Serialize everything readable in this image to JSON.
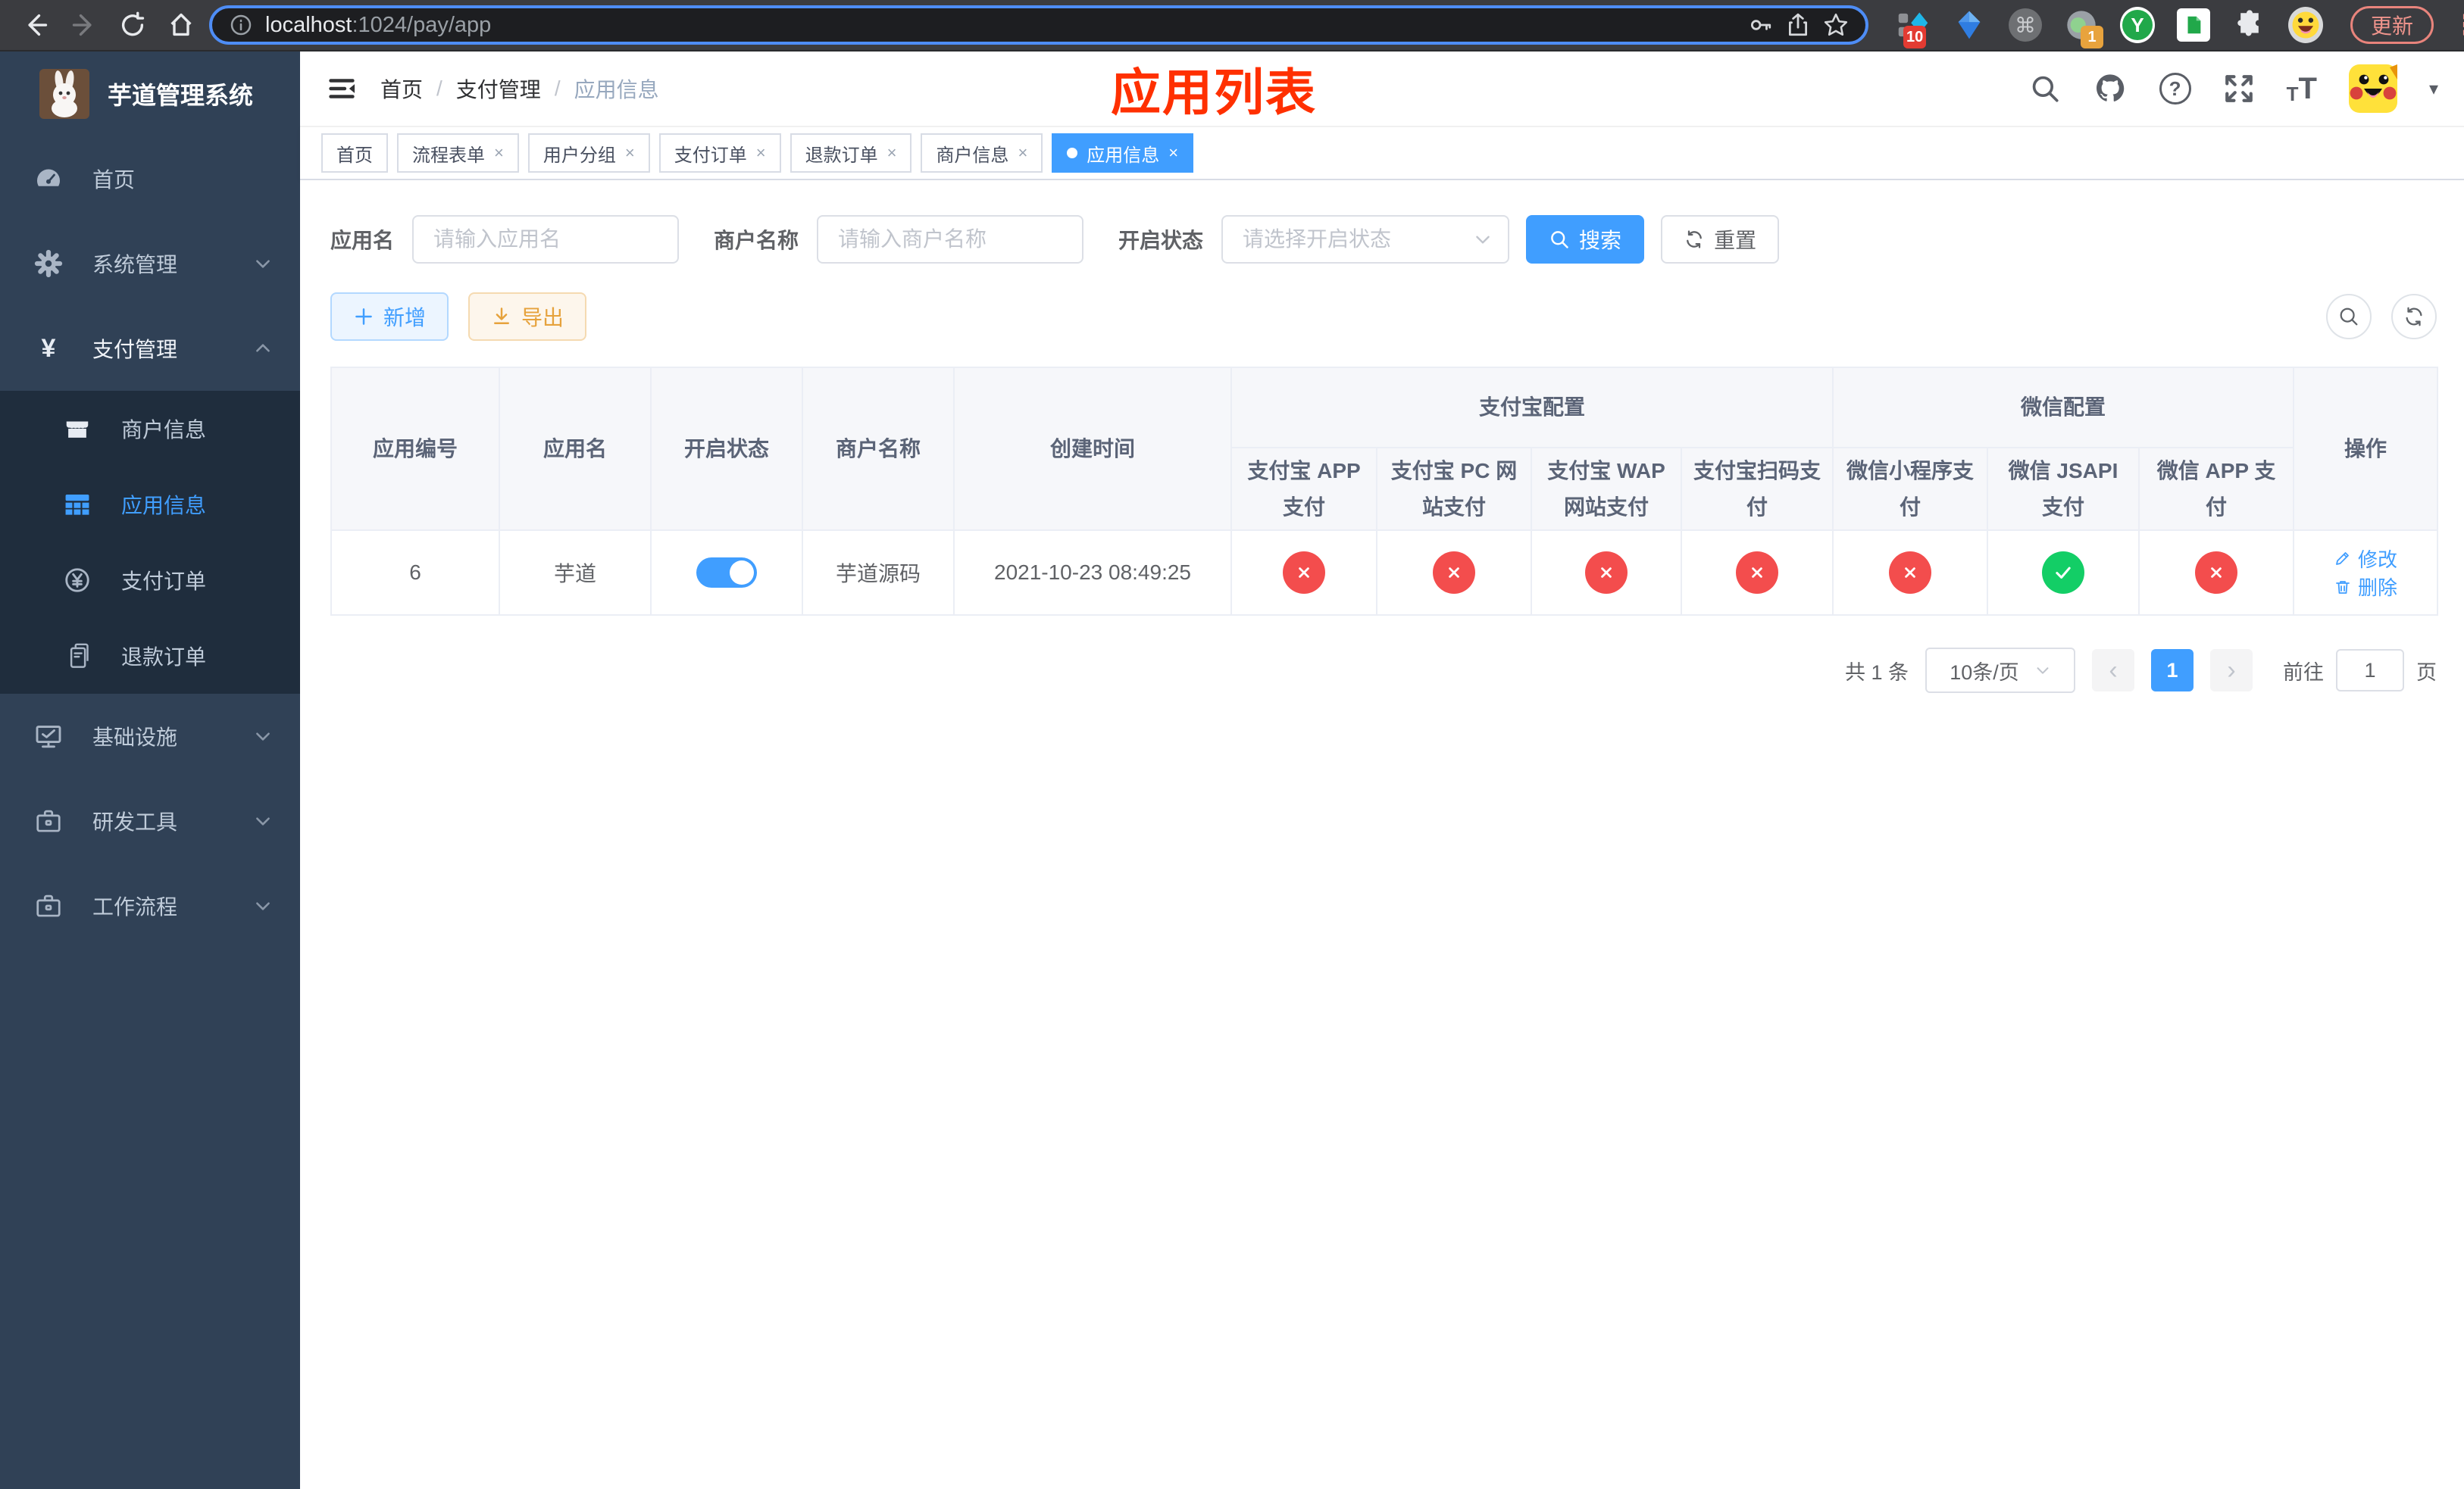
{
  "colors": {
    "primary": "#409eff",
    "danger": "#f34d4d",
    "success": "#13ce66",
    "warning": "#e6a23c",
    "title_red": "#ff3000",
    "sidebar_bg": "#304156",
    "submenu_bg": "#1f2d3d"
  },
  "icons": {
    "question": "?",
    "command": "⌘",
    "kebab": "⋮",
    "caret_down": "▾",
    "yen": "¥",
    "tab_close": "×",
    "page_prev": "‹",
    "page_next": "›",
    "y_logo": "Y",
    "t_small": "T",
    "t_big": "T"
  },
  "browser": {
    "url_host": "localhost",
    "url_rest": ":1024/pay/app",
    "ext_badge_a": "10",
    "ext_badge_b": "1",
    "update_label": "更新"
  },
  "sidebar": {
    "title": "芋道管理系统",
    "menu": [
      {
        "label": "首页"
      },
      {
        "label": "系统管理"
      },
      {
        "label": "支付管理"
      }
    ],
    "submenu": [
      {
        "label": "商户信息"
      },
      {
        "label": "应用信息"
      },
      {
        "label": "支付订单"
      },
      {
        "label": "退款订单"
      }
    ],
    "menu2": [
      {
        "label": "基础设施"
      },
      {
        "label": "研发工具"
      },
      {
        "label": "工作流程"
      }
    ]
  },
  "header": {
    "breadcrumb": [
      "首页",
      "支付管理",
      "应用信息"
    ],
    "sep": "/",
    "overlay_title": "应用列表"
  },
  "tabs": [
    {
      "label": "首页"
    },
    {
      "label": "流程表单"
    },
    {
      "label": "用户分组"
    },
    {
      "label": "支付订单"
    },
    {
      "label": "退款订单"
    },
    {
      "label": "商户信息"
    },
    {
      "label": "应用信息"
    }
  ],
  "filters": {
    "app_name_label": "应用名",
    "app_name_placeholder": "请输入应用名",
    "merchant_label": "商户名称",
    "merchant_placeholder": "请输入商户名称",
    "status_label": "开启状态",
    "status_placeholder": "请选择开启状态",
    "search_label": "搜索",
    "reset_label": "重置"
  },
  "toolbar": {
    "add_label": "新增",
    "export_label": "导出"
  },
  "table": {
    "headers": {
      "id": "应用编号",
      "name": "应用名",
      "status": "开启状态",
      "merchant": "商户名称",
      "created": "创建时间",
      "op": "操作"
    },
    "groups": {
      "alipay": "支付宝配置",
      "wechat": "微信配置"
    },
    "sub": [
      "支付宝 APP 支付",
      "支付宝 PC 网站支付",
      "支付宝 WAP 网站支付",
      "支付宝扫码支付",
      "微信小程序支付",
      "微信 JSAPI 支付",
      "微信 APP 支付"
    ],
    "row": {
      "id": "6",
      "name": "芋道",
      "merchant": "芋道源码",
      "created": "2021-10-23 08:49:25"
    },
    "actions": {
      "edit": "修改",
      "delete": "删除"
    }
  },
  "pagination": {
    "total": "共 1 条",
    "page_size": "10条/页",
    "current": "1",
    "goto_label": "前往",
    "goto_value": "1",
    "unit_label": "页"
  }
}
